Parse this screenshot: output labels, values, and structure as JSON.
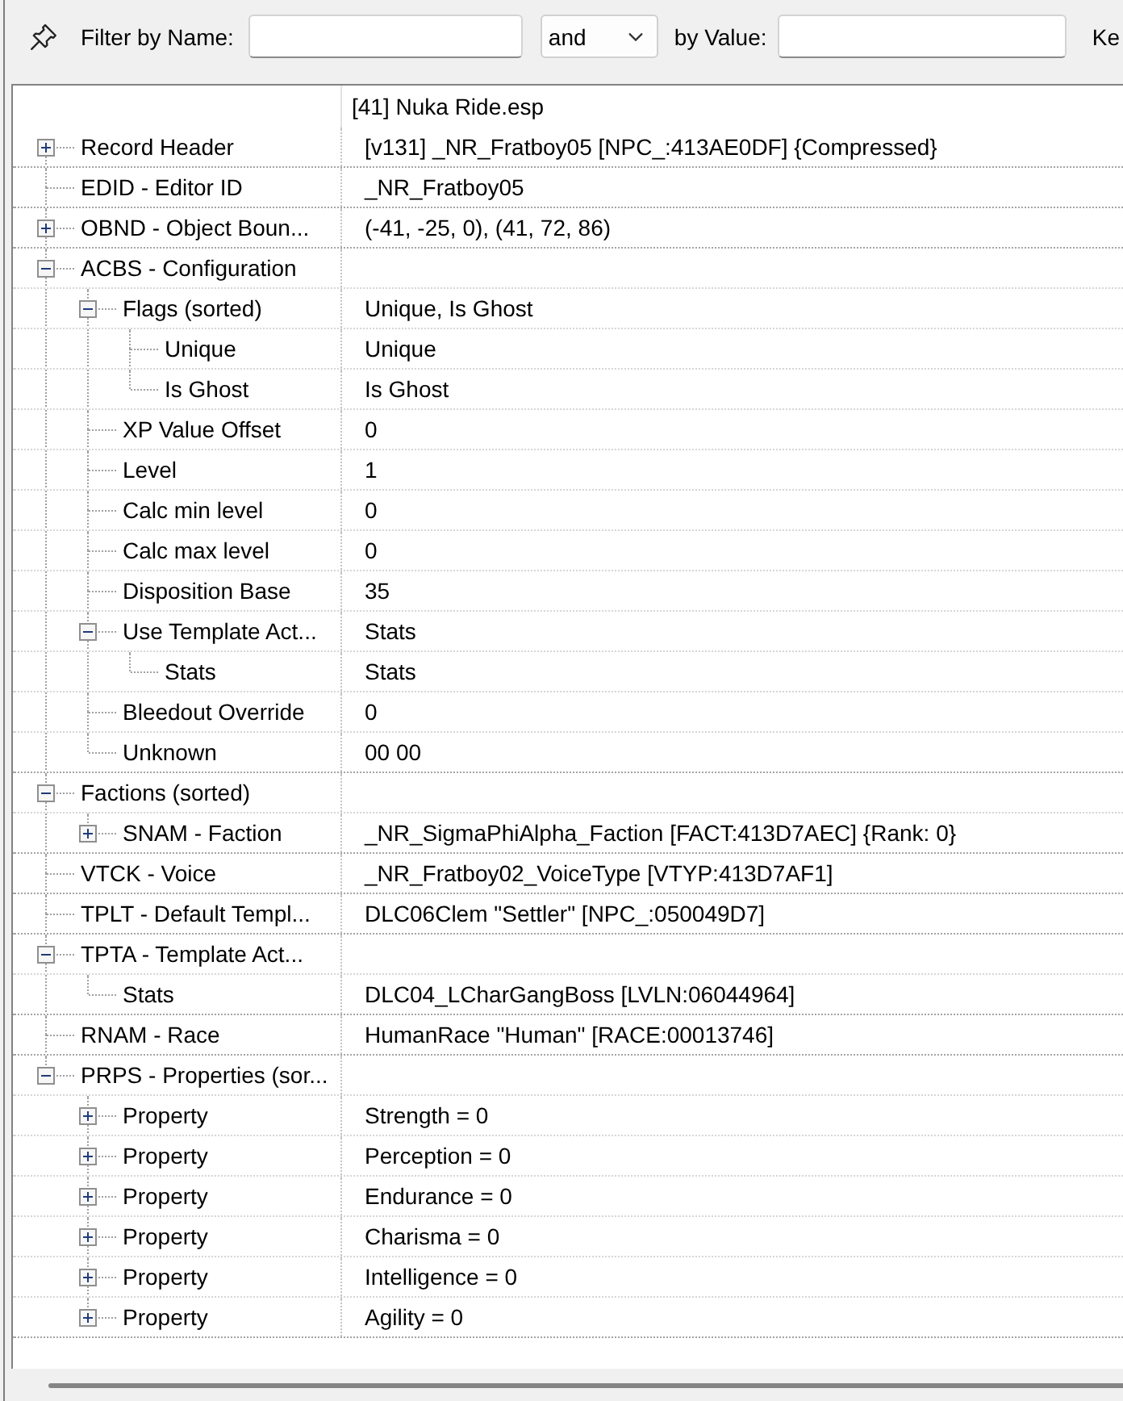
{
  "filter_bar": {
    "name_label": "Filter by Name:",
    "operator": "and",
    "value_label": "by Value:",
    "label_3": "Ke"
  },
  "tree": {
    "header_value": "[41] Nuka Ride.esp",
    "items": [
      {
        "name": "Record Header",
        "value": "[v131] _NR_Fratboy05 [NPC_:413AE0DF] {Compressed}",
        "expanded": false
      },
      {
        "name": "EDID - Editor ID",
        "value": "_NR_Fratboy05"
      },
      {
        "name": "OBND - Object Boun...",
        "value": "(-41, -25, 0), (41, 72, 86)",
        "expanded": false
      },
      {
        "name": "ACBS - Configuration",
        "expanded": true,
        "children": [
          {
            "name": "Flags (sorted)",
            "value": "Unique, Is Ghost",
            "expanded": true,
            "children": [
              {
                "name": "Unique",
                "value": "Unique"
              },
              {
                "name": "Is Ghost",
                "value": "Is Ghost"
              }
            ]
          },
          {
            "name": "XP Value Offset",
            "value": "0"
          },
          {
            "name": "Level",
            "value": "1"
          },
          {
            "name": "Calc min level",
            "value": "0"
          },
          {
            "name": "Calc max level",
            "value": "0"
          },
          {
            "name": "Disposition Base",
            "value": "35"
          },
          {
            "name": "Use Template Act...",
            "value": "Stats",
            "expanded": true,
            "children": [
              {
                "name": "Stats",
                "value": "Stats"
              }
            ]
          },
          {
            "name": "Bleedout Override",
            "value": "0"
          },
          {
            "name": "Unknown",
            "value": "00 00"
          }
        ]
      },
      {
        "name": "Factions (sorted)",
        "expanded": true,
        "children": [
          {
            "name": "SNAM - Faction",
            "value": "_NR_SigmaPhiAlpha_Faction [FACT:413D7AEC] {Rank: 0}",
            "expanded": false
          }
        ]
      },
      {
        "name": "VTCK - Voice",
        "value": "_NR_Fratboy02_VoiceType [VTYP:413D7AF1]"
      },
      {
        "name": "TPLT - Default Templ...",
        "value": "DLC06Clem \"Settler\" [NPC_:050049D7]"
      },
      {
        "name": "TPTA - Template Act...",
        "expanded": true,
        "children": [
          {
            "name": "Stats",
            "value": "DLC04_LCharGangBoss [LVLN:06044964]"
          }
        ]
      },
      {
        "name": "RNAM - Race",
        "value": "HumanRace \"Human\" [RACE:00013746]"
      },
      {
        "name": "PRPS - Properties (sor...",
        "expanded": true,
        "children": [
          {
            "name": "Property",
            "value": "Strength = 0",
            "expanded": false
          },
          {
            "name": "Property",
            "value": "Perception = 0",
            "expanded": false
          },
          {
            "name": "Property",
            "value": "Endurance = 0",
            "expanded": false
          },
          {
            "name": "Property",
            "value": "Charisma = 0",
            "expanded": false
          },
          {
            "name": "Property",
            "value": "Intelligence = 0",
            "expanded": false
          },
          {
            "name": "Property",
            "value": "Agility = 0",
            "expanded": false
          }
        ]
      }
    ]
  }
}
